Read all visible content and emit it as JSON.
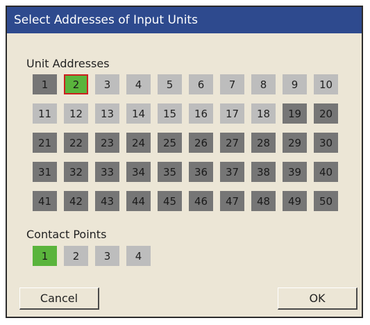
{
  "window": {
    "title": "Select Addresses of Input Units"
  },
  "unit_addresses": {
    "label": "Unit Addresses",
    "rows": [
      [
        {
          "n": "1",
          "s": "dark"
        },
        {
          "n": "2",
          "s": "selected",
          "focus": true
        },
        {
          "n": "3",
          "s": "light"
        },
        {
          "n": "4",
          "s": "light"
        },
        {
          "n": "5",
          "s": "light"
        },
        {
          "n": "6",
          "s": "light"
        },
        {
          "n": "7",
          "s": "light"
        },
        {
          "n": "8",
          "s": "light"
        },
        {
          "n": "9",
          "s": "light"
        },
        {
          "n": "10",
          "s": "light"
        }
      ],
      [
        {
          "n": "11",
          "s": "light"
        },
        {
          "n": "12",
          "s": "light"
        },
        {
          "n": "13",
          "s": "light"
        },
        {
          "n": "14",
          "s": "light"
        },
        {
          "n": "15",
          "s": "light"
        },
        {
          "n": "16",
          "s": "light"
        },
        {
          "n": "17",
          "s": "light"
        },
        {
          "n": "18",
          "s": "light"
        },
        {
          "n": "19",
          "s": "dark"
        },
        {
          "n": "20",
          "s": "dark"
        }
      ],
      [
        {
          "n": "21",
          "s": "dark"
        },
        {
          "n": "22",
          "s": "dark"
        },
        {
          "n": "23",
          "s": "dark"
        },
        {
          "n": "24",
          "s": "dark"
        },
        {
          "n": "25",
          "s": "dark"
        },
        {
          "n": "26",
          "s": "dark"
        },
        {
          "n": "27",
          "s": "dark"
        },
        {
          "n": "28",
          "s": "dark"
        },
        {
          "n": "29",
          "s": "dark"
        },
        {
          "n": "30",
          "s": "dark"
        }
      ],
      [
        {
          "n": "31",
          "s": "dark"
        },
        {
          "n": "32",
          "s": "dark"
        },
        {
          "n": "33",
          "s": "dark"
        },
        {
          "n": "34",
          "s": "dark"
        },
        {
          "n": "35",
          "s": "dark"
        },
        {
          "n": "36",
          "s": "dark"
        },
        {
          "n": "37",
          "s": "dark"
        },
        {
          "n": "38",
          "s": "dark"
        },
        {
          "n": "39",
          "s": "dark"
        },
        {
          "n": "40",
          "s": "dark"
        }
      ],
      [
        {
          "n": "41",
          "s": "dark"
        },
        {
          "n": "42",
          "s": "dark"
        },
        {
          "n": "43",
          "s": "dark"
        },
        {
          "n": "44",
          "s": "dark"
        },
        {
          "n": "45",
          "s": "dark"
        },
        {
          "n": "46",
          "s": "dark"
        },
        {
          "n": "47",
          "s": "dark"
        },
        {
          "n": "48",
          "s": "dark"
        },
        {
          "n": "49",
          "s": "dark"
        },
        {
          "n": "50",
          "s": "dark"
        }
      ]
    ]
  },
  "contact_points": {
    "label": "Contact Points",
    "items": [
      {
        "n": "1",
        "s": "selected"
      },
      {
        "n": "2",
        "s": "light"
      },
      {
        "n": "3",
        "s": "light"
      },
      {
        "n": "4",
        "s": "light"
      }
    ]
  },
  "buttons": {
    "cancel_label": "Cancel",
    "ok_label": "OK"
  },
  "colors": {
    "title_bar": "#2e4a8e",
    "dialog_bg": "#ece6d6",
    "cell_available": "#bdbdbd",
    "cell_unavailable": "#767676",
    "cell_selected": "#5ab43c",
    "focus_outline": "#cc2020"
  }
}
